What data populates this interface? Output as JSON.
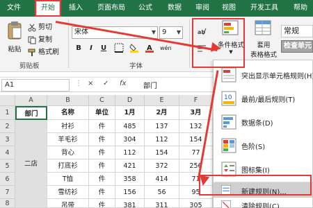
{
  "ribbon_tabs": [
    {
      "label": "文件"
    },
    {
      "label": "开始"
    },
    {
      "label": "插入"
    },
    {
      "label": "页面布局"
    },
    {
      "label": "公式"
    },
    {
      "label": "数据"
    },
    {
      "label": "审阅"
    },
    {
      "label": "视图"
    },
    {
      "label": "开发工具"
    },
    {
      "label": "帮助"
    }
  ],
  "clipboard": {
    "paste": "粘贴",
    "cut": "剪切",
    "copy": "复制",
    "format_painter": "格式刷",
    "group_label": "剪贴板"
  },
  "font": {
    "name": "宋体",
    "size": "9",
    "bold": "B",
    "italic": "I",
    "underline": "U",
    "group_label": "字体",
    "phonetic": "wén"
  },
  "styles": {
    "conditional_format": "条件格式",
    "table_format_line1": "套用",
    "table_format_line2": "表格格式",
    "cell_style_normal": "常规",
    "cell_style_check": "检查单元"
  },
  "formula_bar": {
    "name_box": "A1",
    "cancel": "×",
    "enter": "✓",
    "fx": "fx",
    "value": "部门"
  },
  "columns": [
    "A",
    "B",
    "C",
    "D",
    "E",
    "F"
  ],
  "rows": [
    "1",
    "2",
    "3",
    "4",
    "5",
    "6",
    "7",
    "8"
  ],
  "table": {
    "headers": [
      "部门",
      "名称",
      "单位",
      "1月",
      "2月",
      "3月"
    ],
    "merged_dept": "二店",
    "data": [
      [
        "衬衫",
        "件",
        "485",
        "137",
        "132"
      ],
      [
        "羊毛衫",
        "件",
        "304",
        "112",
        "154"
      ],
      [
        "背心",
        "件",
        "112",
        "154",
        "77"
      ],
      [
        "打底衫",
        "件",
        "421",
        "372",
        "256"
      ],
      [
        "T恤",
        "件",
        "358",
        "414",
        "71"
      ],
      [
        "雪纺衫",
        "件",
        "156",
        "56",
        "95"
      ],
      [
        "吊带",
        "件",
        "381",
        "311",
        "305"
      ]
    ]
  },
  "cf_menu": {
    "items": [
      {
        "label": "突出显示单元格规则(H)",
        "icon": "highlight-rules-icon"
      },
      {
        "label": "最前/最后规则(T)",
        "icon": "top-bottom-icon"
      },
      {
        "label": "数据条(D)",
        "icon": "data-bars-icon"
      },
      {
        "label": "色阶(S)",
        "icon": "color-scales-icon"
      },
      {
        "label": "图标集(I)",
        "icon": "icon-sets-icon"
      },
      {
        "label": "新建规则(N)...",
        "icon": "new-rule-icon"
      },
      {
        "label": "清除规则(C)",
        "icon": "clear-rules-icon"
      }
    ]
  },
  "colors": {
    "excel_green": "#217346",
    "annotation_red": "#e53935",
    "menu_highlight": "#cfcfcf"
  }
}
